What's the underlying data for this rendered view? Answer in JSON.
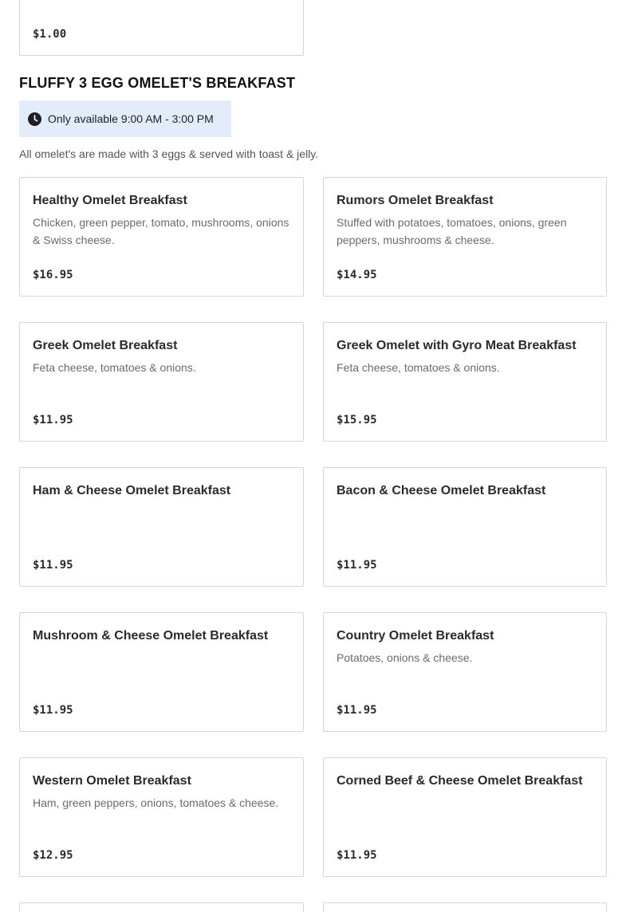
{
  "previous_item": {
    "price": "$1.00"
  },
  "section": {
    "title": "FLUFFY 3 EGG OMELET'S BREAKFAST",
    "availability": "Only available 9:00 AM - 3:00 PM",
    "availability_icon": "clock-icon",
    "note": "All omelet's are made with 3 eggs & served with toast & jelly."
  },
  "items": [
    {
      "name": "Healthy Omelet Breakfast",
      "description": "Chicken, green pepper, tomato, mushrooms, onions & Swiss cheese.",
      "price": "$16.95"
    },
    {
      "name": "Rumors Omelet Breakfast",
      "description": "Stuffed with potatoes, tomatoes, onions, green peppers, mushrooms & cheese.",
      "price": "$14.95"
    },
    {
      "name": "Greek Omelet Breakfast",
      "description": "Feta cheese, tomatoes & onions.",
      "price": "$11.95"
    },
    {
      "name": "Greek Omelet with Gyro Meat Breakfast",
      "description": "Feta cheese, tomatoes & onions.",
      "price": "$15.95"
    },
    {
      "name": "Ham & Cheese Omelet Breakfast",
      "description": "",
      "price": "$11.95"
    },
    {
      "name": "Bacon & Cheese Omelet Breakfast",
      "description": "",
      "price": "$11.95"
    },
    {
      "name": "Mushroom & Cheese Omelet Breakfast",
      "description": "",
      "price": "$11.95"
    },
    {
      "name": "Country Omelet Breakfast",
      "description": "Potatoes, onions & cheese.",
      "price": "$11.95"
    },
    {
      "name": "Western Omelet Breakfast",
      "description": "Ham, green peppers, onions, tomatoes & cheese.",
      "price": "$12.95"
    },
    {
      "name": "Corned Beef & Cheese Omelet Breakfast",
      "description": "",
      "price": "$11.95"
    },
    {
      "name": "",
      "description": "",
      "price": ""
    },
    {
      "name": "",
      "description": "",
      "price": ""
    }
  ]
}
